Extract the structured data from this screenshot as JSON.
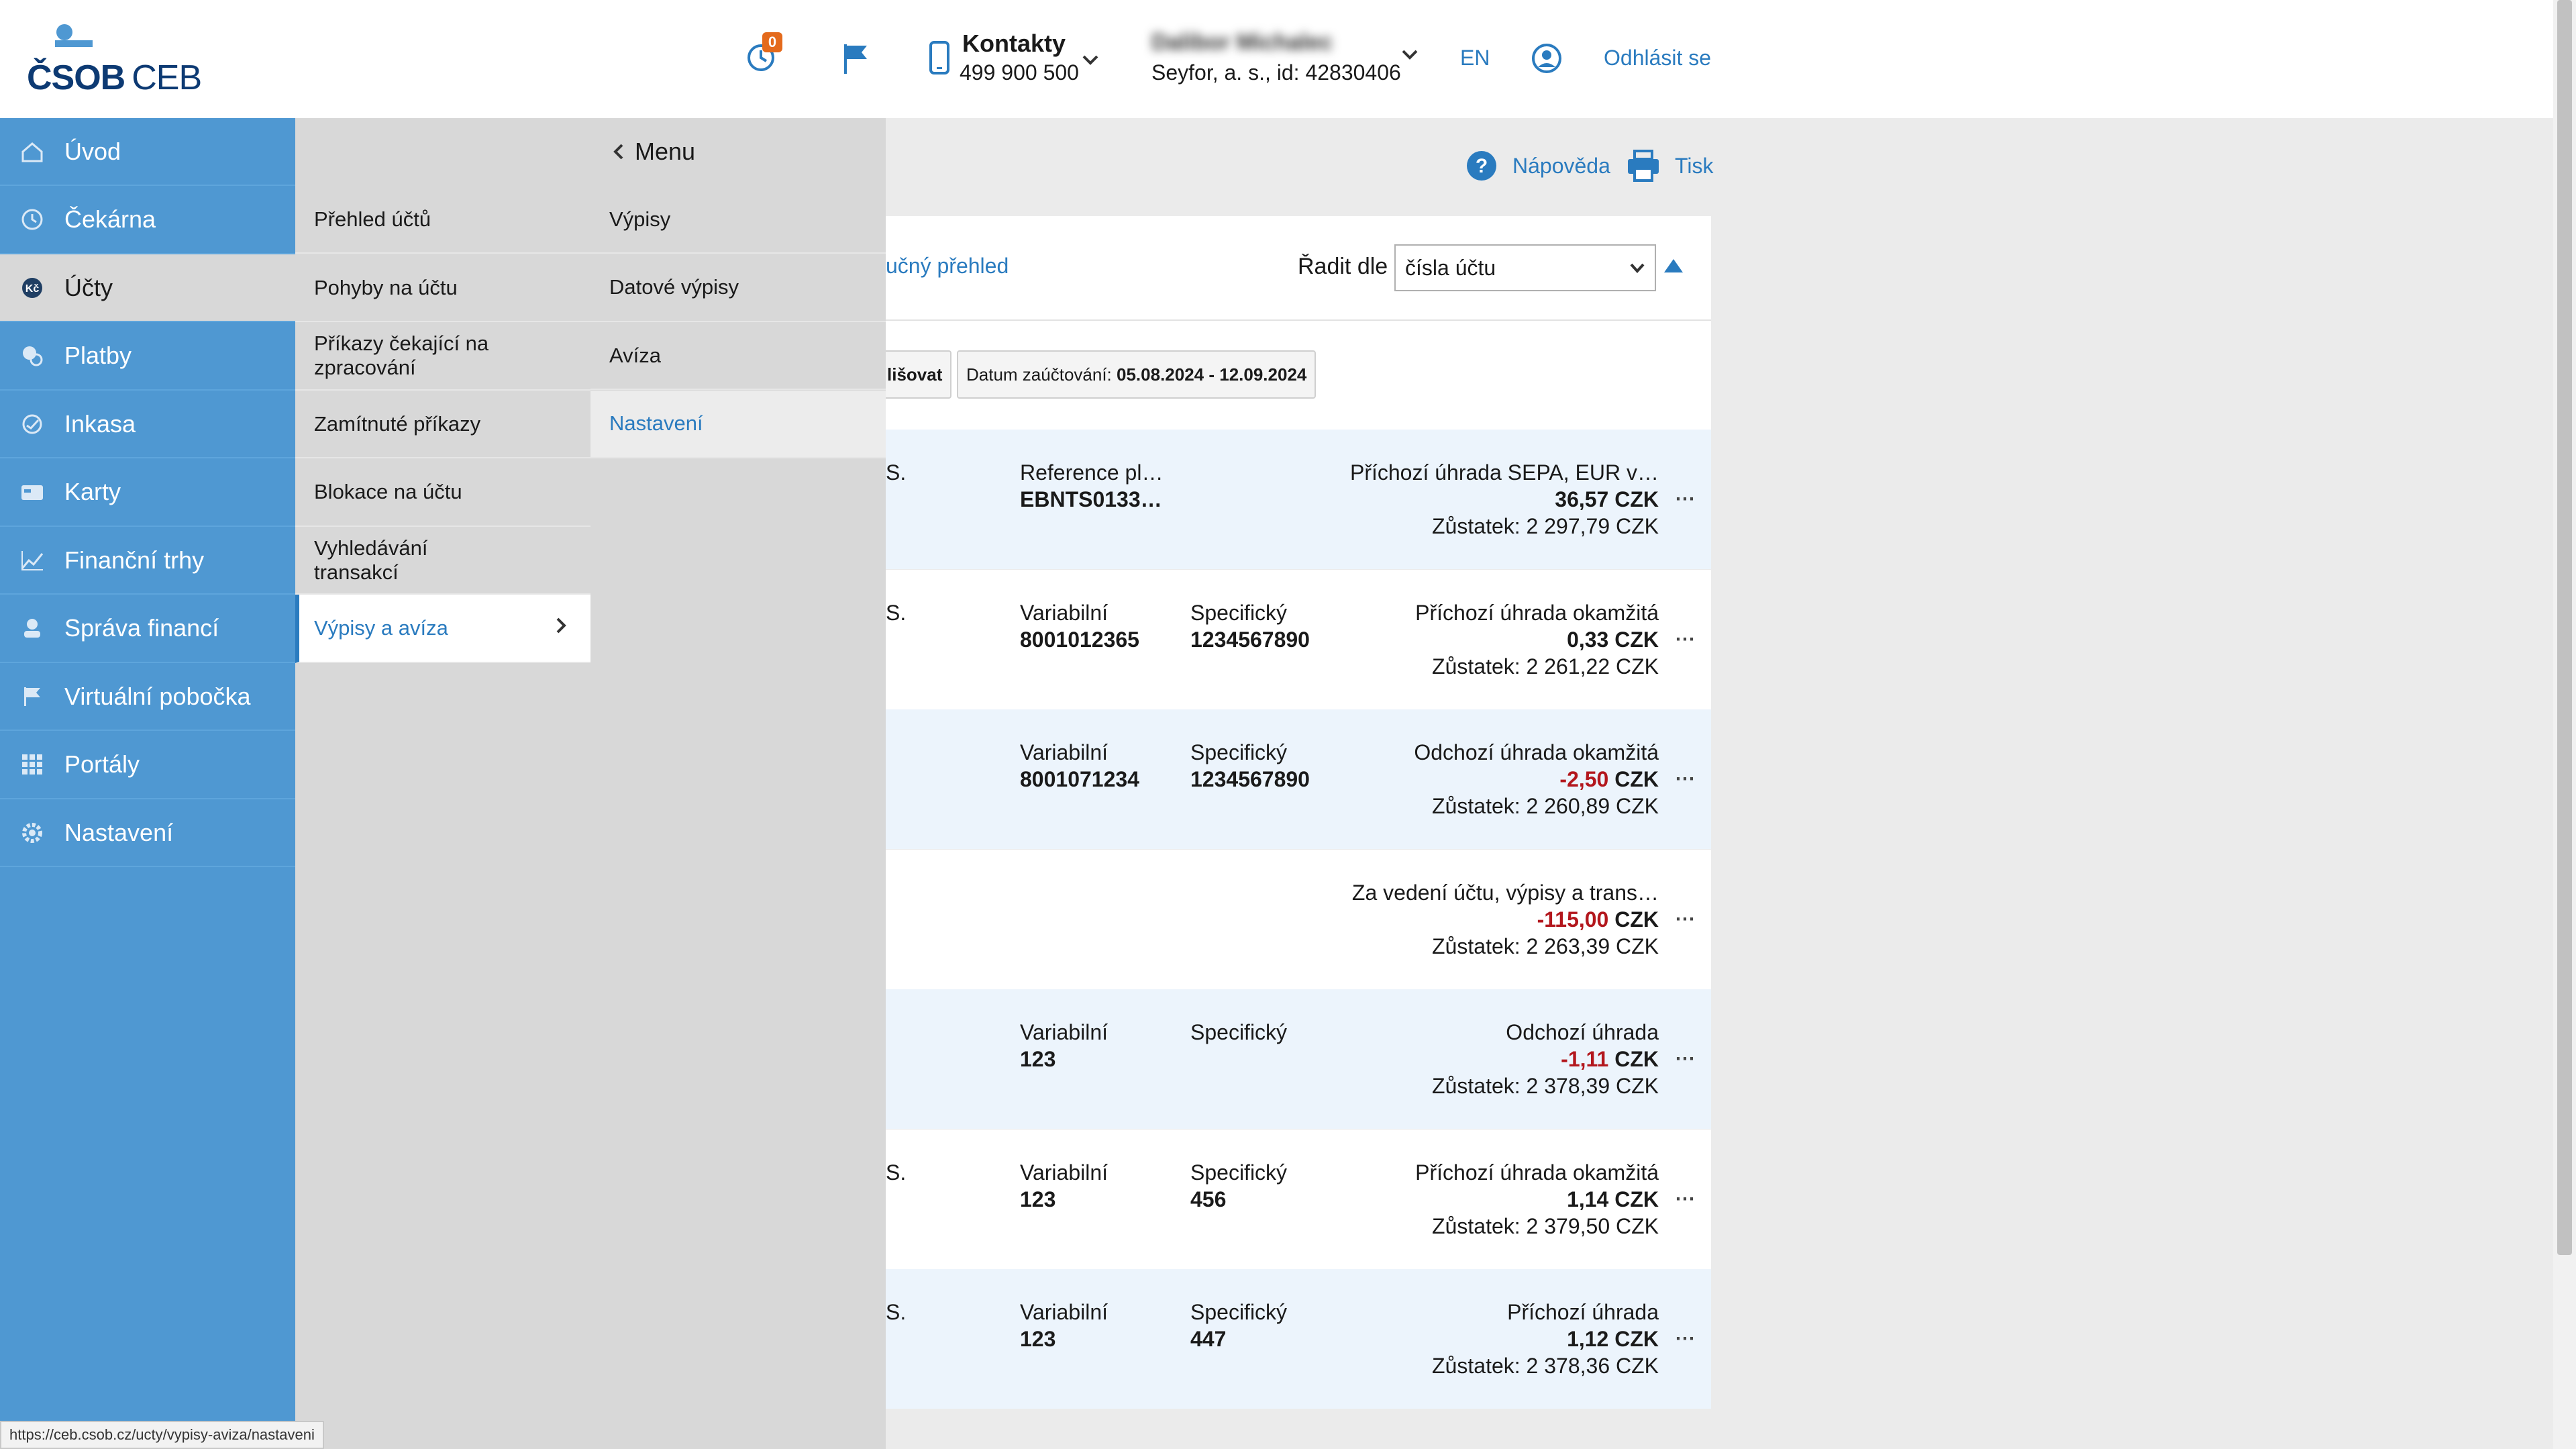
{
  "brand": {
    "logo_text": "ČSOB",
    "logo_sub": "CEB",
    "accent": "#2a7bbf",
    "sidebar_bg": "#4f98d2",
    "negative": "#b3171d"
  },
  "header": {
    "notifications_badge": "0",
    "contacts_title": "Kontakty",
    "contacts_phone": "499 900 500",
    "user_name": "Dalibor Michalec",
    "user_company": "Seyfor, a. s., id: 42830406",
    "lang": "EN",
    "logout": "Odhlásit se"
  },
  "sidebar": {
    "items": [
      {
        "label": "Úvod",
        "icon": "home-icon"
      },
      {
        "label": "Čekárna",
        "icon": "clock-icon"
      },
      {
        "label": "Účty",
        "icon": "accounts-icon"
      },
      {
        "label": "Platby",
        "icon": "payments-icon"
      },
      {
        "label": "Inkasa",
        "icon": "collection-icon"
      },
      {
        "label": "Karty",
        "icon": "card-icon"
      },
      {
        "label": "Finanční trhy",
        "icon": "chart-icon"
      },
      {
        "label": "Správa financí",
        "icon": "finance-icon"
      },
      {
        "label": "Virtuální pobočka",
        "icon": "flag-icon"
      },
      {
        "label": "Portály",
        "icon": "grid-icon"
      },
      {
        "label": "Nastavení",
        "icon": "gear-icon"
      }
    ],
    "active": "Účty"
  },
  "submenu": {
    "items": [
      {
        "label": "Přehled účtů"
      },
      {
        "label": "Pohyby na účtu"
      },
      {
        "label": "Příkazy čekající na zpracování"
      },
      {
        "label": "Zamítnuté příkazy"
      },
      {
        "label": "Blokace na účtu"
      },
      {
        "label": "Vyhledávání transakcí"
      },
      {
        "label": "Výpisy a avíza"
      }
    ]
  },
  "submenu3": {
    "back_label": "Menu",
    "items": [
      {
        "label": "Výpisy"
      },
      {
        "label": "Datové výpisy"
      },
      {
        "label": "Avíza"
      },
      {
        "label": "Nastavení"
      }
    ]
  },
  "toolbar": {
    "help": "Nápověda",
    "print": "Tisk"
  },
  "list": {
    "view_link": "učný přehled",
    "sort_label": "Řadit dle",
    "sort_value": "čísla účtu",
    "filter_chip_1": "lišovat",
    "filter_chip_2_label": "Datum zaúčtování:",
    "filter_chip_2_value": "05.08.2024 - 12.09.2024",
    "rows": [
      {
        "c1": "S.",
        "ref_label": "Reference pl…",
        "ref_value": "EBNTS0133…",
        "spec_label": "",
        "spec_value": "",
        "desc": "Příchozí úhrada SEPA, EUR v…",
        "amount": "36,57",
        "currency": "CZK",
        "negative": false,
        "balance": "Zůstatek: 2 297,79 CZK"
      },
      {
        "c1": "S.",
        "ref_label": "Variabilní",
        "ref_value": "8001012365",
        "spec_label": "Specifický",
        "spec_value": "1234567890",
        "desc": "Příchozí úhrada okamžitá",
        "amount": "0,33",
        "currency": "CZK",
        "negative": false,
        "balance": "Zůstatek: 2 261,22 CZK"
      },
      {
        "c1": "",
        "ref_label": "Variabilní",
        "ref_value": "8001071234",
        "spec_label": "Specifický",
        "spec_value": "1234567890",
        "desc": "Odchozí úhrada okamžitá",
        "amount": "-2,50",
        "currency": "CZK",
        "negative": true,
        "balance": "Zůstatek: 2 260,89 CZK"
      },
      {
        "c1": "",
        "ref_label": "",
        "ref_value": "",
        "spec_label": "",
        "spec_value": "",
        "desc": "Za vedení účtu, výpisy a trans…",
        "amount": "-115,00",
        "currency": "CZK",
        "negative": true,
        "balance": "Zůstatek: 2 263,39 CZK"
      },
      {
        "c1": "",
        "ref_label": "Variabilní",
        "ref_value": "123",
        "spec_label": "Specifický",
        "spec_value": "",
        "desc": "Odchozí úhrada",
        "amount": "-1,11",
        "currency": "CZK",
        "negative": true,
        "balance": "Zůstatek: 2 378,39 CZK"
      },
      {
        "c1": "S.",
        "ref_label": "Variabilní",
        "ref_value": "123",
        "spec_label": "Specifický",
        "spec_value": "456",
        "desc": "Příchozí úhrada okamžitá",
        "amount": "1,14",
        "currency": "CZK",
        "negative": false,
        "balance": "Zůstatek: 2 379,50 CZK"
      },
      {
        "c1": "S.",
        "ref_label": "Variabilní",
        "ref_value": "123",
        "spec_label": "Specifický",
        "spec_value": "447",
        "desc": "Příchozí úhrada",
        "amount": "1,12",
        "currency": "CZK",
        "negative": false,
        "balance": "Zůstatek: 2 378,36 CZK"
      }
    ],
    "more_label": "⋯"
  },
  "statusbar": {
    "url": "https://ceb.csob.cz/ucty/vypisy-aviza/nastaveni"
  }
}
